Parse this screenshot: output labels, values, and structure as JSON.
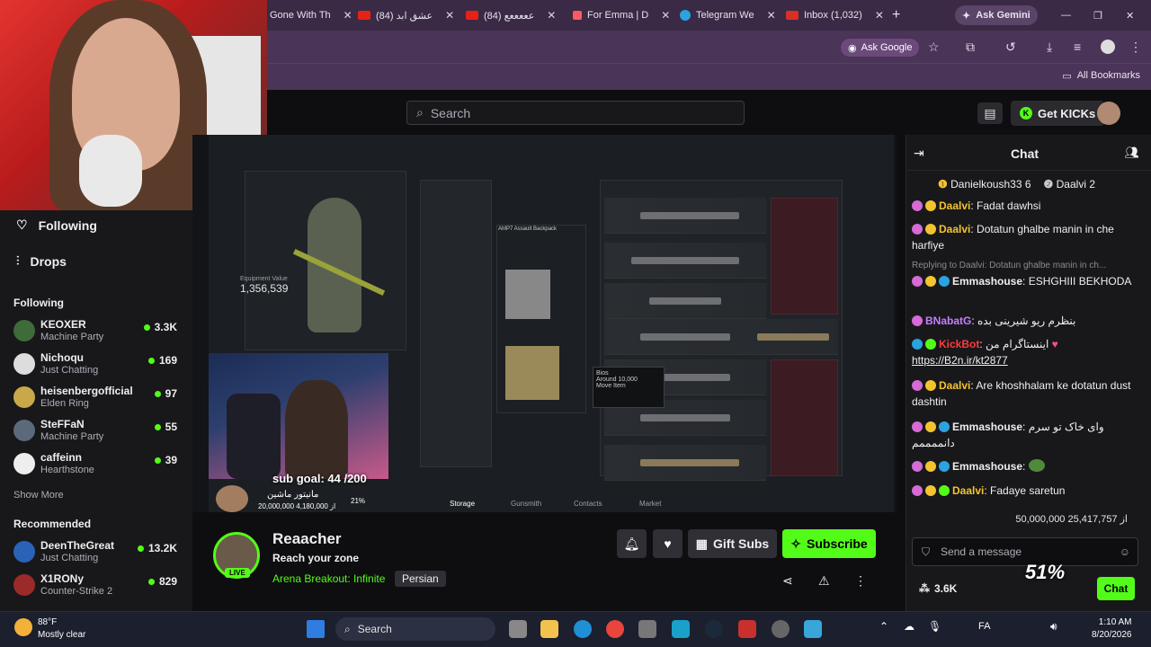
{
  "browser": {
    "tabs": [
      {
        "label": "Gone With Th"
      },
      {
        "label": "(84) عشق ابد"
      },
      {
        "label": "(84) عععععع"
      },
      {
        "label": "For Emma | D"
      },
      {
        "label": "Telegram We"
      },
      {
        "label": "Inbox (1,032)"
      }
    ],
    "ask_gemini": "Ask Gemini",
    "ask_google": "Ask Google",
    "all_bookmarks": "All Bookmarks"
  },
  "header": {
    "search_placeholder": "Search",
    "get_kicks": "Get KICKs"
  },
  "sidebar": {
    "following_link": "Following",
    "drops_link": "Drops",
    "following_heading": "Following",
    "following": [
      {
        "name": "KEOXER",
        "category": "Machine Party",
        "viewers": "3.3K"
      },
      {
        "name": "Nichoqu",
        "category": "Just Chatting",
        "viewers": "169"
      },
      {
        "name": "heisenbergofficial",
        "category": "Elden Ring",
        "viewers": "97"
      },
      {
        "name": "SteFFaN",
        "category": "Machine Party",
        "viewers": "55"
      },
      {
        "name": "caffeinn",
        "category": "Hearthstone",
        "viewers": "39"
      }
    ],
    "show_more": "Show More",
    "recommended_heading": "Recommended",
    "recommended": [
      {
        "name": "DeenTheGreat",
        "category": "Just Chatting",
        "viewers": "13.2K"
      },
      {
        "name": "X1RONy",
        "category": "Counter-Strike 2",
        "viewers": "829"
      }
    ]
  },
  "video": {
    "equipment_value": "1,356,539",
    "equipment_label": "Equipment Value",
    "sub_goal": "sub goal: 44 /200",
    "donate_line1": "مانیتور ماشین",
    "donate_line2": "20,000,000 از 4,180,000",
    "donate_pct": "21%",
    "game_tabs": [
      "Storage",
      "Gunsmith",
      "Contacts",
      "Market"
    ],
    "backpack_label": "AMP7 Assault Backpack",
    "tooltip_items": [
      "Around 10,000",
      "Move Item"
    ],
    "tooltip_title": "Bios"
  },
  "stream": {
    "name": "Reaacher",
    "title": "Reach your zone",
    "category": "Arena Breakout: Infinite",
    "language": "Persian",
    "live": "LIVE",
    "gift_subs": "Gift Subs",
    "subscribe": "Subscribe"
  },
  "chat": {
    "title": "Chat",
    "pinned": [
      {
        "user": "Danielkoush33",
        "count": "6"
      },
      {
        "user": "Daalvi",
        "count": "2"
      }
    ],
    "messages": [
      {
        "user": "Daalvi",
        "text": "Fadat dawhsi",
        "color": "#f4c430"
      },
      {
        "user": "Daalvi",
        "text": "Dotatun ghalbe manin in che harfiye",
        "color": "#f4c430"
      },
      {
        "user": "Emmashouse",
        "text": "ESHGHIII BEKHODA",
        "color": "#ffffff"
      },
      {
        "user": "BNabatG",
        "text": "بنظرم ریو شیرینی بده",
        "color": "#c77dff"
      },
      {
        "user": "KickBot",
        "text": "اینستاگرام من",
        "color": "#ff3b3b"
      },
      {
        "user": "",
        "text": "https://B2n.ir/kt2877",
        "color": "#ffffff"
      },
      {
        "user": "Daalvi",
        "text": "Are khoshhalam ke dotatun dust dashtin",
        "color": "#f4c430"
      },
      {
        "user": "Emmashouse",
        "text": "وای خاک تو سرم دانممممم",
        "color": "#ffffff"
      },
      {
        "user": "Emmashouse",
        "text": "",
        "color": "#ffffff"
      },
      {
        "user": "Daalvi",
        "text": "Fadaye saretun",
        "color": "#f4c430"
      }
    ],
    "reply_text": "Replying to Daalvi: Dotatun ghalbe manin in ch...",
    "overlay_text": "50,000,000 از 25,417,757",
    "send_placeholder": "Send a message",
    "viewer_count": "3.6K",
    "chat_button": "Chat",
    "alert_pct": "51%"
  },
  "taskbar": {
    "temp": "88°F",
    "weather": "Mostly clear",
    "search": "Search",
    "lang": "FA",
    "time": "1:10 AM",
    "date": "8/20/2026"
  },
  "colors": {
    "accent": "#53fc18",
    "chrome": "#3a2a45",
    "bg": "#0e0e10"
  }
}
